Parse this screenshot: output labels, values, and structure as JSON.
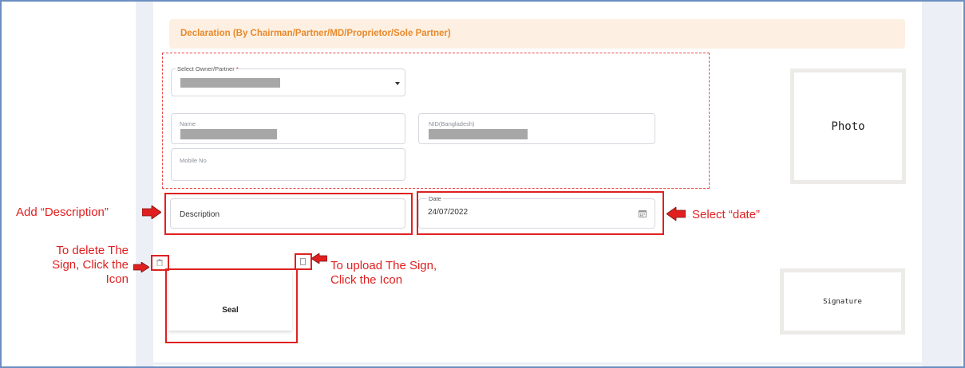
{
  "declaration": {
    "title": "Declaration (By Chairman/Partner/MD/Proprietor/Sole Partner)"
  },
  "form": {
    "owner_select": {
      "label": "Select Owner/Partner",
      "required_mark": "*"
    },
    "name_field": {
      "label": "Name"
    },
    "nid_field": {
      "label": "NID(Bangladesh)"
    },
    "mobile_field": {
      "label": "Mobile No"
    },
    "description_field": {
      "placeholder": "Description"
    },
    "date_field": {
      "label": "Date",
      "value": "24/07/2022"
    }
  },
  "photo": {
    "label": "Photo"
  },
  "seal": {
    "label": "Seal"
  },
  "signature": {
    "label": "Signature"
  },
  "annotations": {
    "add_description": "Add “Description”",
    "select_date": "Select “date”",
    "delete_sign_line1": "To delete The",
    "delete_sign_line2": "Sign, Click the",
    "delete_sign_line3": "Icon",
    "upload_sign_line1": "To upload The Sign,",
    "upload_sign_line2": "Click the Icon"
  },
  "icons": {
    "calendar": "calendar-icon",
    "delete": "trash-icon",
    "upload": "upload-icon",
    "dropdown": "caret-down-icon"
  },
  "colors": {
    "accent_orange": "#e8892b",
    "annotation_red": "#e02020",
    "frame_blue": "#6c8ebf"
  }
}
